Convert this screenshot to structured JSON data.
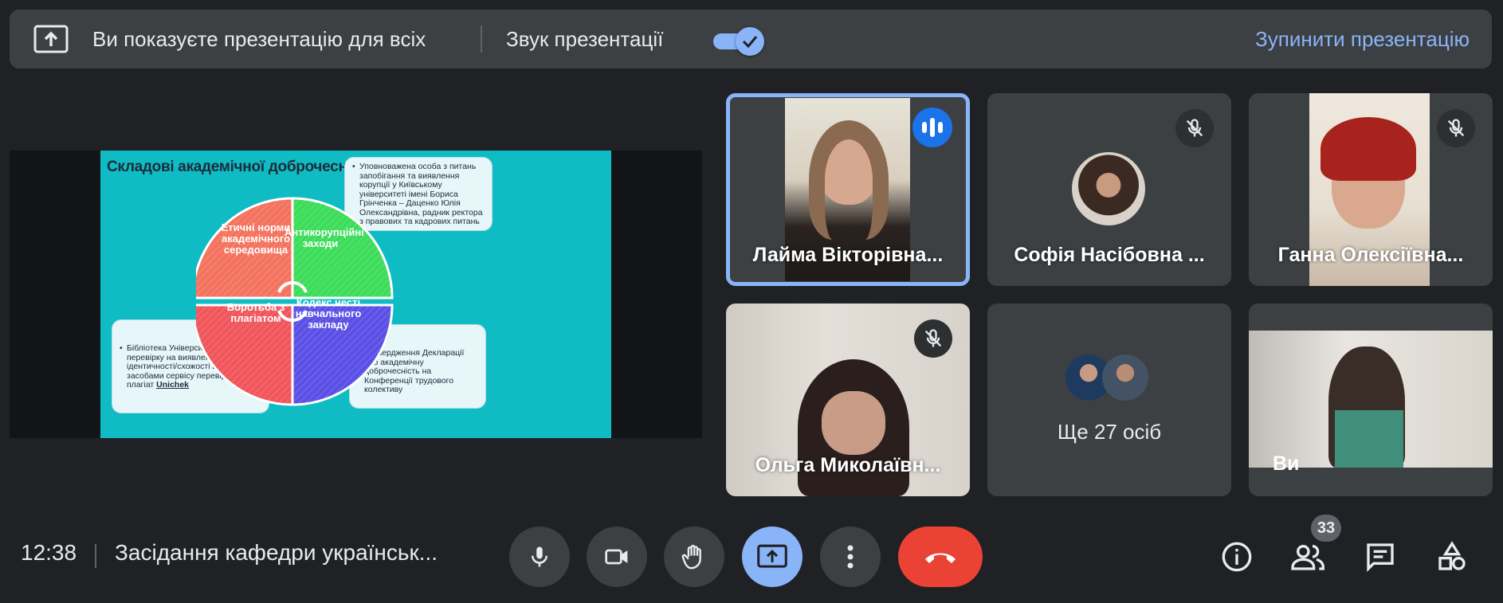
{
  "topbar": {
    "presenting_text": "Ви показуєте презентацію для всіх",
    "sound_label": "Звук презентації",
    "sound_enabled": true,
    "stop_label": "Зупинити презентацію"
  },
  "slide": {
    "title": "Складові академічної доброчесності",
    "callout_top": "Уповноважена особа з питань запобігання та виявлення корупції у Київському університеті імені Бориса Грінченка – Даценко Юлія Олександрівна, радник ректора з правових та кадрових питань",
    "callout_left": "Бібліотека Університету здійснює перевірку на виявлення збігів/ідентичності/схожості в текстах засобами сервісу перевірки на плагіат",
    "callout_left_link": "Unichek",
    "callout_right": "Затвердження Декларації про академічну доброчесність на Конференції трудового колективу",
    "segments": [
      {
        "label": "Етичні норми академічного середовища",
        "color": "#f4735f"
      },
      {
        "label": "Антикорупційні заходи",
        "color": "#3ddc5a"
      },
      {
        "label": "Боротьба з плагіатом",
        "color": "#f0565c"
      },
      {
        "label": "Кодекс честі навчального закладу",
        "color": "#5b50e6"
      }
    ]
  },
  "participants": [
    {
      "name": "Лайма Вікторівна...",
      "state": "speaking"
    },
    {
      "name": "Софія Насібовна ...",
      "state": "muted"
    },
    {
      "name": "Ганна Олексіївна...",
      "state": "muted"
    },
    {
      "name": "Ольга Миколаївн...",
      "state": "muted"
    },
    {
      "name": "Ще 27 осіб",
      "state": "group"
    },
    {
      "name": "Ви",
      "state": "self"
    }
  ],
  "bottombar": {
    "time": "12:38",
    "meeting_title": "Засідання кафедри українськ...",
    "participants_count": "33",
    "icons": [
      "mic-icon",
      "camera-icon",
      "raise-hand-icon",
      "present-screen-icon",
      "more-options-icon",
      "end-call-icon",
      "info-icon",
      "people-icon",
      "chat-icon",
      "activities-icon"
    ]
  }
}
